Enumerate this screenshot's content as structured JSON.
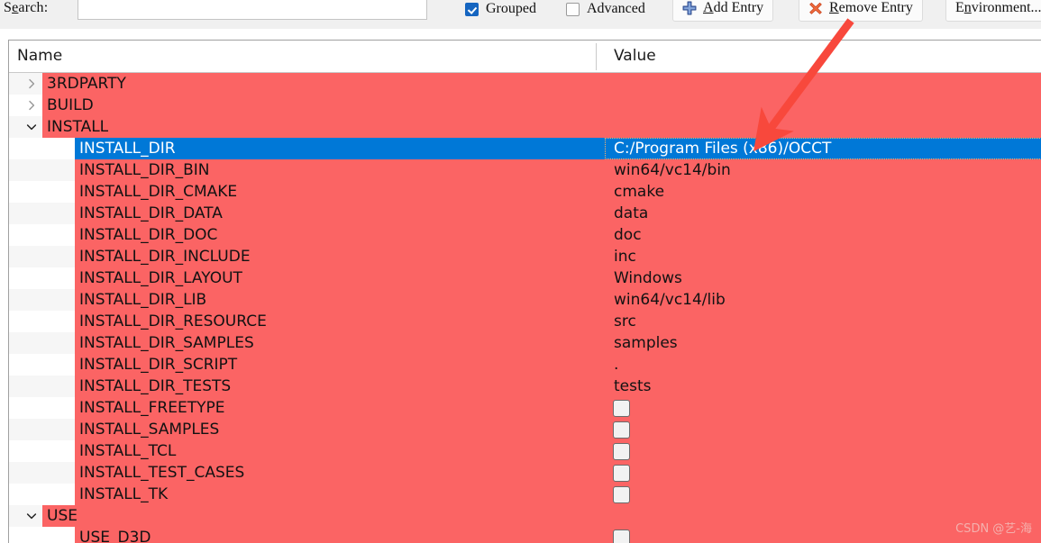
{
  "toolbar": {
    "search_label_pre": "S",
    "search_label_mnemonic": "e",
    "search_label_post": "arch:",
    "search_value": "",
    "search_placeholder": "",
    "grouped_label": "Grouped",
    "grouped_checked": true,
    "advanced_label": "Advanced",
    "advanced_checked": false,
    "add_entry": {
      "pre": "",
      "mnemonic": "A",
      "post": "dd Entry",
      "icon": "plus-icon"
    },
    "remove_entry": {
      "pre": "",
      "mnemonic": "R",
      "post": "emove Entry",
      "icon": "cross-icon"
    },
    "environment": {
      "pre": "E",
      "mnemonic": "n",
      "post": "vironment...",
      "icon": "none"
    }
  },
  "colors": {
    "row_red": "#fb6464",
    "selection_blue": "#0078d7",
    "focus_outline": "#ffb36b",
    "arrow_red": "#f8483c",
    "accent_checkbox": "#1565c0"
  },
  "table": {
    "columns": [
      "Name",
      "Value"
    ],
    "rows": [
      {
        "name": "3RDPARTY",
        "level": 0,
        "twisty": "chevron-right-icon",
        "value_type": "none",
        "value": ""
      },
      {
        "name": "BUILD",
        "level": 0,
        "twisty": "chevron-right-icon",
        "value_type": "none",
        "value": ""
      },
      {
        "name": "INSTALL",
        "level": 0,
        "twisty": "chevron-down-icon",
        "value_type": "none",
        "value": ""
      },
      {
        "name": "INSTALL_DIR",
        "level": 1,
        "twisty": "none",
        "selected": true,
        "value_type": "text",
        "value": "C:/Program Files (x86)/OCCT"
      },
      {
        "name": "INSTALL_DIR_BIN",
        "level": 1,
        "twisty": "none",
        "value_type": "text",
        "value": "win64/vc14/bin"
      },
      {
        "name": "INSTALL_DIR_CMAKE",
        "level": 1,
        "twisty": "none",
        "value_type": "text",
        "value": "cmake"
      },
      {
        "name": "INSTALL_DIR_DATA",
        "level": 1,
        "twisty": "none",
        "value_type": "text",
        "value": "data"
      },
      {
        "name": "INSTALL_DIR_DOC",
        "level": 1,
        "twisty": "none",
        "value_type": "text",
        "value": "doc"
      },
      {
        "name": "INSTALL_DIR_INCLUDE",
        "level": 1,
        "twisty": "none",
        "value_type": "text",
        "value": "inc"
      },
      {
        "name": "INSTALL_DIR_LAYOUT",
        "level": 1,
        "twisty": "none",
        "value_type": "text",
        "value": "Windows"
      },
      {
        "name": "INSTALL_DIR_LIB",
        "level": 1,
        "twisty": "none",
        "value_type": "text",
        "value": "win64/vc14/lib"
      },
      {
        "name": "INSTALL_DIR_RESOURCE",
        "level": 1,
        "twisty": "none",
        "value_type": "text",
        "value": "src"
      },
      {
        "name": "INSTALL_DIR_SAMPLES",
        "level": 1,
        "twisty": "none",
        "value_type": "text",
        "value": "samples"
      },
      {
        "name": "INSTALL_DIR_SCRIPT",
        "level": 1,
        "twisty": "none",
        "value_type": "text",
        "value": "."
      },
      {
        "name": "INSTALL_DIR_TESTS",
        "level": 1,
        "twisty": "none",
        "value_type": "text",
        "value": "tests"
      },
      {
        "name": "INSTALL_FREETYPE",
        "level": 1,
        "twisty": "none",
        "value_type": "checkbox",
        "value": "",
        "checked": false
      },
      {
        "name": "INSTALL_SAMPLES",
        "level": 1,
        "twisty": "none",
        "value_type": "checkbox",
        "value": "",
        "checked": false
      },
      {
        "name": "INSTALL_TCL",
        "level": 1,
        "twisty": "none",
        "value_type": "checkbox",
        "value": "",
        "checked": false
      },
      {
        "name": "INSTALL_TEST_CASES",
        "level": 1,
        "twisty": "none",
        "value_type": "checkbox",
        "value": "",
        "checked": false
      },
      {
        "name": "INSTALL_TK",
        "level": 1,
        "twisty": "none",
        "value_type": "checkbox",
        "value": "",
        "checked": false
      },
      {
        "name": "USE",
        "level": 0,
        "twisty": "chevron-down-icon",
        "value_type": "none",
        "value": ""
      },
      {
        "name": "USE_D3D",
        "level": 1,
        "twisty": "none",
        "value_type": "checkbox",
        "value": "",
        "checked": false
      }
    ]
  },
  "watermark": "CSDN @艺-海"
}
